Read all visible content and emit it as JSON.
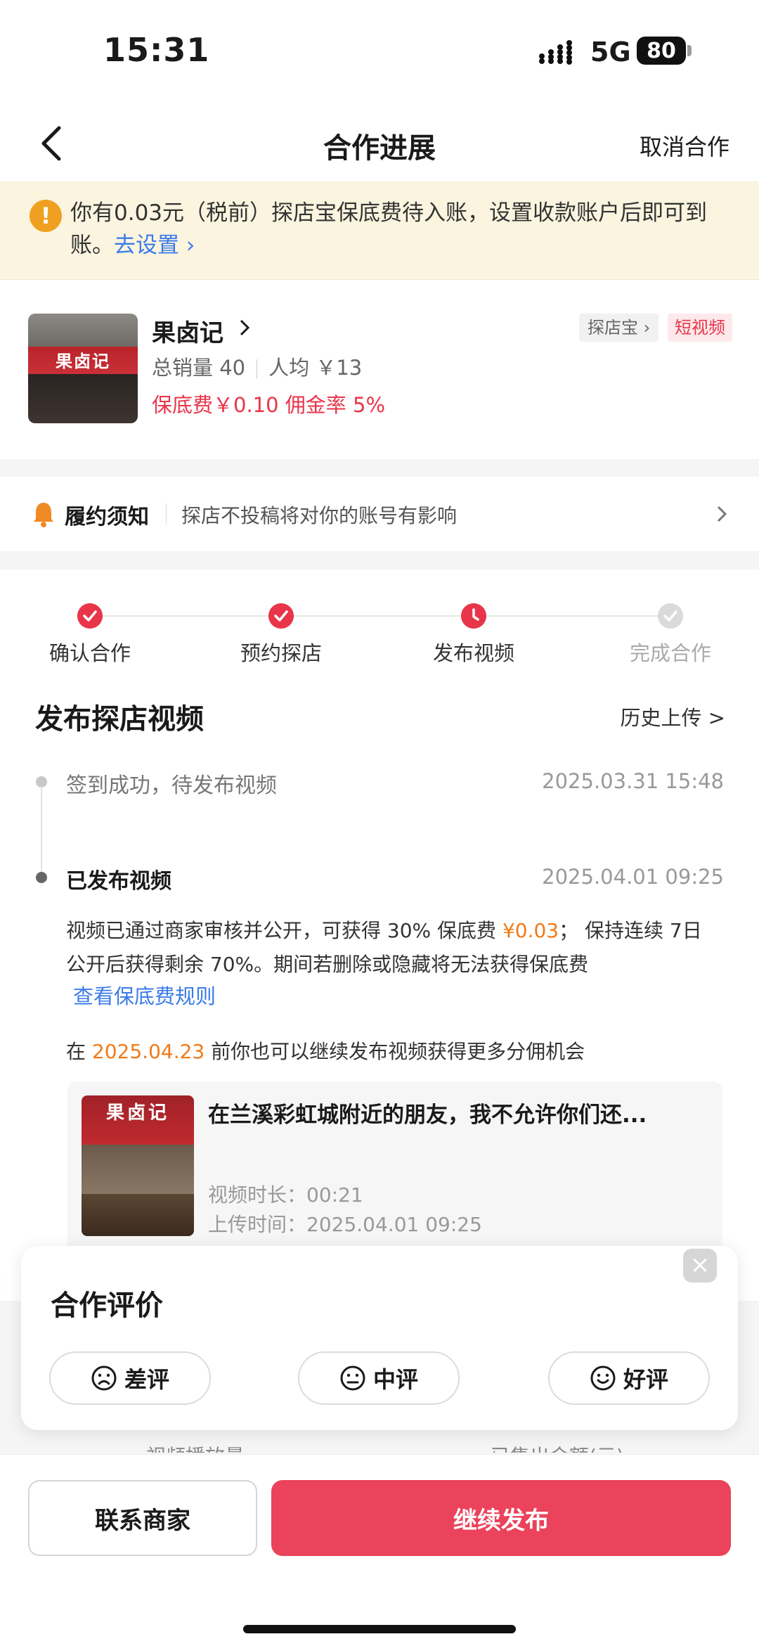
{
  "status_bar": {
    "time": "15:31",
    "network": "5G",
    "battery": "80"
  },
  "nav": {
    "title": "合作进展",
    "cancel_label": "取消合作"
  },
  "notice": {
    "text": "你有0.03元（税前）探店宝保底费待入账，设置收款账户后即可到账。",
    "link": "去设置 ›"
  },
  "store": {
    "name": "果卤记",
    "image_sign": "果卤记",
    "sales": "总销量 40",
    "avg_price": "人均 ￥13",
    "fee_line": "保底费￥0.10 佣金率 5%",
    "tag_tandianbao": "探店宝 ›",
    "tag_video": "短视频"
  },
  "fulfill": {
    "title": "履约须知",
    "text": "探店不投稿将对你的账号有影响"
  },
  "steps": [
    {
      "label": "确认合作",
      "state": "done"
    },
    {
      "label": "预约探店",
      "state": "done"
    },
    {
      "label": "发布视频",
      "state": "current"
    },
    {
      "label": "完成合作",
      "state": "pending"
    }
  ],
  "section": {
    "title": "发布探店视频",
    "history": "历史上传 >"
  },
  "timeline": [
    {
      "text": "签到成功，待发布视频",
      "time": "2025.03.31 15:48"
    },
    {
      "text": "已发布视频",
      "time": "2025.04.01 09:25"
    }
  ],
  "desc": {
    "part1": "视频已通过商家审核并公开，可获得 30% 保底费 ",
    "amount": "¥0.03",
    "part2": "； 保持连续 7日公开后获得剩余 70%。期间若删除或隐藏将无法获得保底费",
    "rule_link": "查看保底费规则",
    "more_prefix": "在 ",
    "more_date": "2025.04.23",
    "more_suffix": " 前你也可以继续发布视频获得更多分佣机会"
  },
  "video": {
    "title": "在兰溪彩虹城附近的朋友，我不允许你们还...",
    "thumb_sign": "果卤记",
    "duration": "视频时长：00:21",
    "upload_time": "上传时间：2025.04.01 09:25"
  },
  "rating": {
    "title": "合作评价",
    "close": "×",
    "options": [
      "差评",
      "中评",
      "好评"
    ]
  },
  "behind": {
    "left": "视频播放量",
    "right": "已售出金额(元)"
  },
  "bottom": {
    "contact": "联系商家",
    "publish": "继续发布"
  },
  "colors": {
    "accent": "#ea435b",
    "link": "#3b7be8",
    "orange": "#f07a18",
    "notice_bg": "#fbf4df"
  }
}
